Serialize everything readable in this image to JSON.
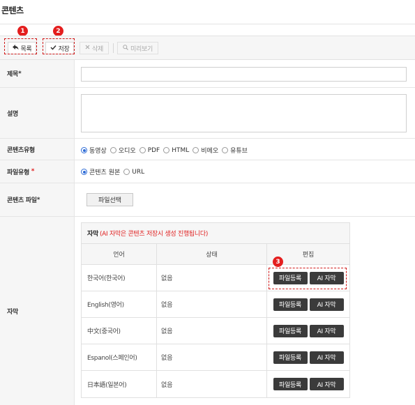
{
  "page_title": "콘텐츠",
  "toolbar": {
    "list_label": "목록",
    "save_label": "저장",
    "delete_label": "삭제",
    "preview_label": "미리보기"
  },
  "markers": [
    "1",
    "2",
    "3"
  ],
  "form": {
    "title_label": "제목",
    "title_required": "*",
    "title_value": "",
    "desc_label": "설명",
    "desc_value": "",
    "content_type_label": "콘텐츠유형",
    "content_types": [
      "동영상",
      "오디오",
      "PDF",
      "HTML",
      "비메오",
      "유튜브"
    ],
    "content_type_selected": "동영상",
    "file_type_label": "파일유형",
    "file_type_required": "*",
    "file_types": [
      "콘텐츠 원본",
      "URL"
    ],
    "file_type_selected": "콘텐츠 원본",
    "content_file_label": "콘텐츠 파일",
    "content_file_required": "*",
    "file_select_label": "파일선택",
    "subtitle_label": "자막"
  },
  "subtitles": {
    "header_title": "자막",
    "header_note": "(AI 자막은 콘텐츠 저장시 생성 진행됩니다)",
    "columns": [
      "언어",
      "상태",
      "편집"
    ],
    "register_label": "파일등록",
    "ai_label": "AI 자막",
    "rows": [
      {
        "language": "한국어(한국어)",
        "status": "없음"
      },
      {
        "language": "English(영어)",
        "status": "없음"
      },
      {
        "language": "中文(중국어)",
        "status": "없음"
      },
      {
        "language": "Espanol(스페인어)",
        "status": "없음"
      },
      {
        "language": "日本語(일본어)",
        "status": "없음"
      }
    ]
  },
  "colors": {
    "marker_red": "#e41e1e",
    "radio_blue": "#2d6bd6",
    "dark_button": "#3b3b3b"
  }
}
